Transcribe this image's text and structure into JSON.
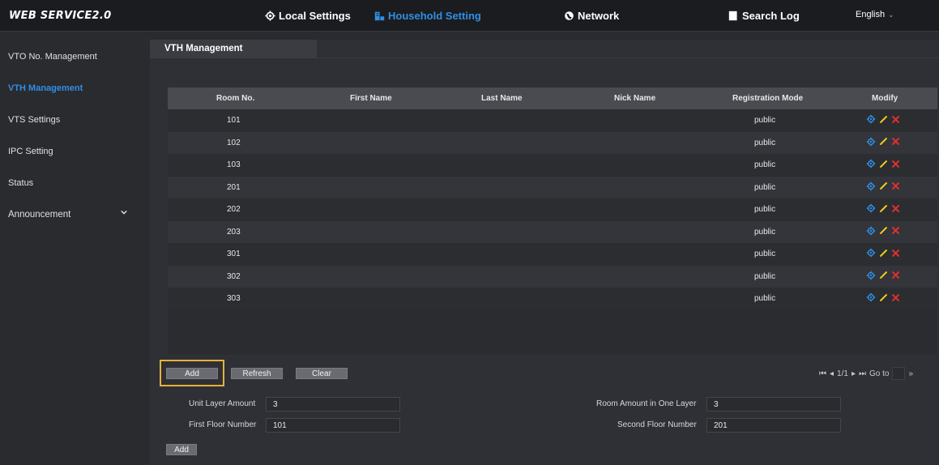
{
  "app": {
    "brand": "WEB SERVICE2.0"
  },
  "topnav": {
    "local_settings": "Local Settings",
    "household_setting": "Household Setting",
    "network": "Network",
    "search_log": "Search Log",
    "language": "English"
  },
  "sidebar": {
    "items": [
      {
        "label": "VTO No. Management"
      },
      {
        "label": "VTH Management"
      },
      {
        "label": "VTS Settings"
      },
      {
        "label": "IPC Setting"
      },
      {
        "label": "Status"
      },
      {
        "label": "Announcement"
      }
    ]
  },
  "tab": {
    "title": "VTH Management"
  },
  "table": {
    "columns": [
      "Room No.",
      "First Name",
      "Last Name",
      "Nick Name",
      "Registration Mode",
      "Modify"
    ],
    "rows": [
      {
        "room": "101",
        "first": "",
        "last": "",
        "nick": "",
        "mode": "public"
      },
      {
        "room": "102",
        "first": "",
        "last": "",
        "nick": "",
        "mode": "public"
      },
      {
        "room": "103",
        "first": "",
        "last": "",
        "nick": "",
        "mode": "public"
      },
      {
        "room": "201",
        "first": "",
        "last": "",
        "nick": "",
        "mode": "public"
      },
      {
        "room": "202",
        "first": "",
        "last": "",
        "nick": "",
        "mode": "public"
      },
      {
        "room": "203",
        "first": "",
        "last": "",
        "nick": "",
        "mode": "public"
      },
      {
        "room": "301",
        "first": "",
        "last": "",
        "nick": "",
        "mode": "public"
      },
      {
        "room": "302",
        "first": "",
        "last": "",
        "nick": "",
        "mode": "public"
      },
      {
        "room": "303",
        "first": "",
        "last": "",
        "nick": "",
        "mode": "public"
      }
    ]
  },
  "actions": {
    "add": "Add",
    "refresh": "Refresh",
    "clear": "Clear"
  },
  "pager": {
    "first": "⏮",
    "prev": "◂",
    "page": "1/1",
    "next": "▸",
    "last": "⏭",
    "goto": "Go to",
    "go": "»"
  },
  "form": {
    "unit_layer_amount_label": "Unit Layer Amount",
    "unit_layer_amount_value": "3",
    "room_amount_label": "Room Amount in One Layer",
    "room_amount_value": "3",
    "first_floor_label": "First Floor Number",
    "first_floor_value": "101",
    "second_floor_label": "Second Floor Number",
    "second_floor_value": "201",
    "add_button": "Add"
  },
  "colors": {
    "accent": "#2f8fe6",
    "highlight": "#e4b23a",
    "delete": "#e03030",
    "edit": "#f0d020"
  }
}
